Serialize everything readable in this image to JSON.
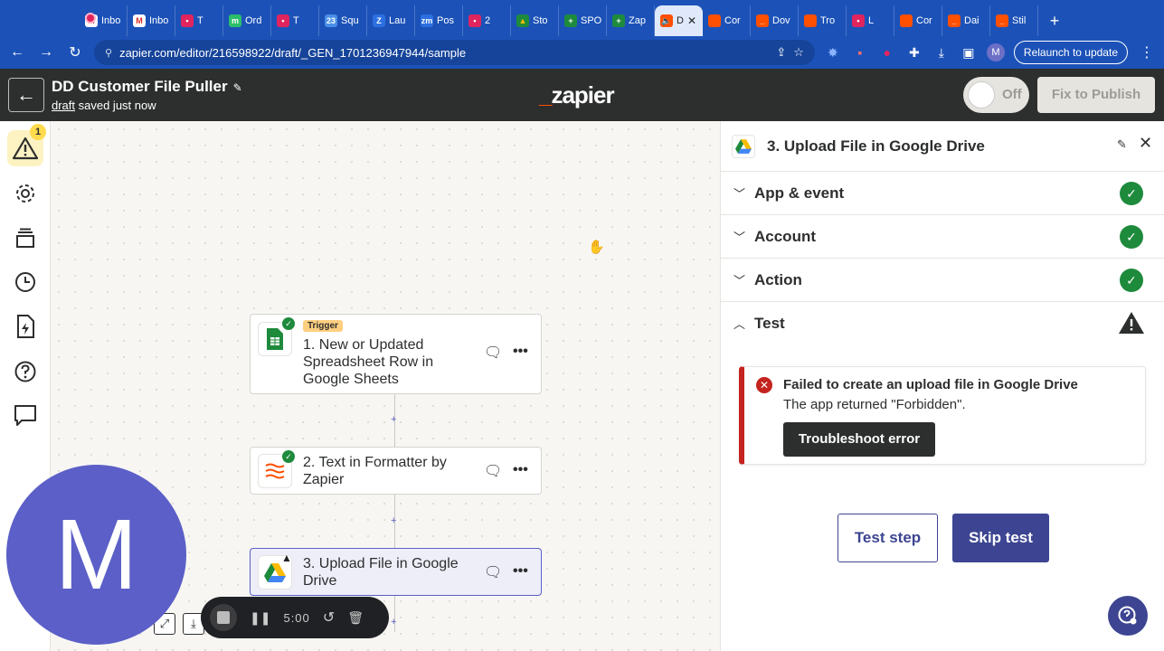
{
  "browser": {
    "tabs": [
      {
        "label": "Inbo",
        "fav_color": "#ffffff",
        "fav_text": "M",
        "fav_fg": "#d93025"
      },
      {
        "label": "Inbo",
        "fav_color": "#ffffff",
        "fav_text": "M",
        "fav_fg": "#d93025"
      },
      {
        "label": "T",
        "fav_color": "#e0245e",
        "fav_text": "•",
        "fav_fg": "#ffffff"
      },
      {
        "label": "Ord",
        "fav_color": "#2bbf6a",
        "fav_text": "m",
        "fav_fg": "#ffffff"
      },
      {
        "label": "T",
        "fav_color": "#e0245e",
        "fav_text": "•",
        "fav_fg": "#ffffff"
      },
      {
        "label": "Squ",
        "fav_color": "#4a8fe7",
        "fav_text": "23",
        "fav_fg": "#ffffff"
      },
      {
        "label": "Lau",
        "fav_color": "#2c6fe0",
        "fav_text": "Z",
        "fav_fg": "#ffffff"
      },
      {
        "label": "Pos",
        "fav_color": "#2c6fe0",
        "fav_text": "zm",
        "fav_fg": "#ffffff"
      },
      {
        "label": "2",
        "fav_color": "#e0245e",
        "fav_text": "•",
        "fav_fg": "#ffffff"
      },
      {
        "label": "Sto",
        "fav_color": "#1e8a3c",
        "fav_text": "▲",
        "fav_fg": "#fbbc04"
      },
      {
        "label": "SPO",
        "fav_color": "#1e8a3c",
        "fav_text": "+",
        "fav_fg": "#ffffff"
      },
      {
        "label": "Zap",
        "fav_color": "#1e8a3c",
        "fav_text": "+",
        "fav_fg": "#ffffff"
      },
      {
        "label": "D",
        "fav_color": "#ff4f00",
        "fav_text": "🔈",
        "fav_fg": "#ffffff",
        "active": true
      },
      {
        "label": "Cor",
        "fav_color": "#ff4f00",
        "fav_text": "",
        "fav_fg": "#ffffff"
      },
      {
        "label": "Dov",
        "fav_color": "#ff4f00",
        "fav_text": "_",
        "fav_fg": "#ffffff"
      },
      {
        "label": "Tro",
        "fav_color": "#ff4f00",
        "fav_text": "",
        "fav_fg": "#ffffff"
      },
      {
        "label": "L",
        "fav_color": "#e0245e",
        "fav_text": "•",
        "fav_fg": "#ffffff"
      },
      {
        "label": "Cor",
        "fav_color": "#ff4f00",
        "fav_text": "",
        "fav_fg": "#ffffff"
      },
      {
        "label": "Dai",
        "fav_color": "#ff4f00",
        "fav_text": "_",
        "fav_fg": "#ffffff"
      },
      {
        "label": "Stil",
        "fav_color": "#ff4f00",
        "fav_text": "_",
        "fav_fg": "#ffffff"
      }
    ],
    "new_tab": "+",
    "url": "zapier.com/editor/216598922/draft/_GEN_1701236947944/sample",
    "profile_initial": "M",
    "relaunch_label": "Relaunch to update"
  },
  "header": {
    "back_icon": "←",
    "zap_title": "DD Customer File Puller",
    "pencil_icon": "✎",
    "status_link": "draft",
    "status_text": " saved just now",
    "logo_prefix": "_",
    "logo": "zapier",
    "toggle_label": "Off",
    "publish_label": "Fix to Publish"
  },
  "sidebar": {
    "warning_badge": "1"
  },
  "canvas": {
    "steps": [
      {
        "tag": "Trigger",
        "text": "1. New or Updated Spreadsheet Row in Google Sheets",
        "status": "ok"
      },
      {
        "text": "2. Text in Formatter by Zapier",
        "status": "ok"
      },
      {
        "text": "3. Upload File in Google Drive",
        "status": "warning"
      }
    ],
    "more_icon": "•••",
    "plus": "+"
  },
  "panel": {
    "title": "3. Upload File in Google Drive",
    "sections": [
      {
        "name": "App & event",
        "status": "ok"
      },
      {
        "name": "Account",
        "status": "ok"
      },
      {
        "name": "Action",
        "status": "ok"
      },
      {
        "name": "Test",
        "status": "warning"
      }
    ],
    "error": {
      "title": "Failed to create an upload file in Google Drive",
      "message": "The app returned \"Forbidden\".",
      "button": "Troubleshoot error"
    },
    "test_step_label": "Test step",
    "skip_test_label": "Skip test"
  },
  "overlay": {
    "camera_initial": "M",
    "recording_time": "5:00"
  },
  "colors": {
    "browser_blue": "#1c52b8",
    "header_dark": "#2d2e2e",
    "zapier_orange": "#ff4f00",
    "brand_purple": "#3d4592",
    "success_green": "#1e8a3c",
    "error_red": "#c4231e",
    "selected_border": "#5b5fc7"
  }
}
